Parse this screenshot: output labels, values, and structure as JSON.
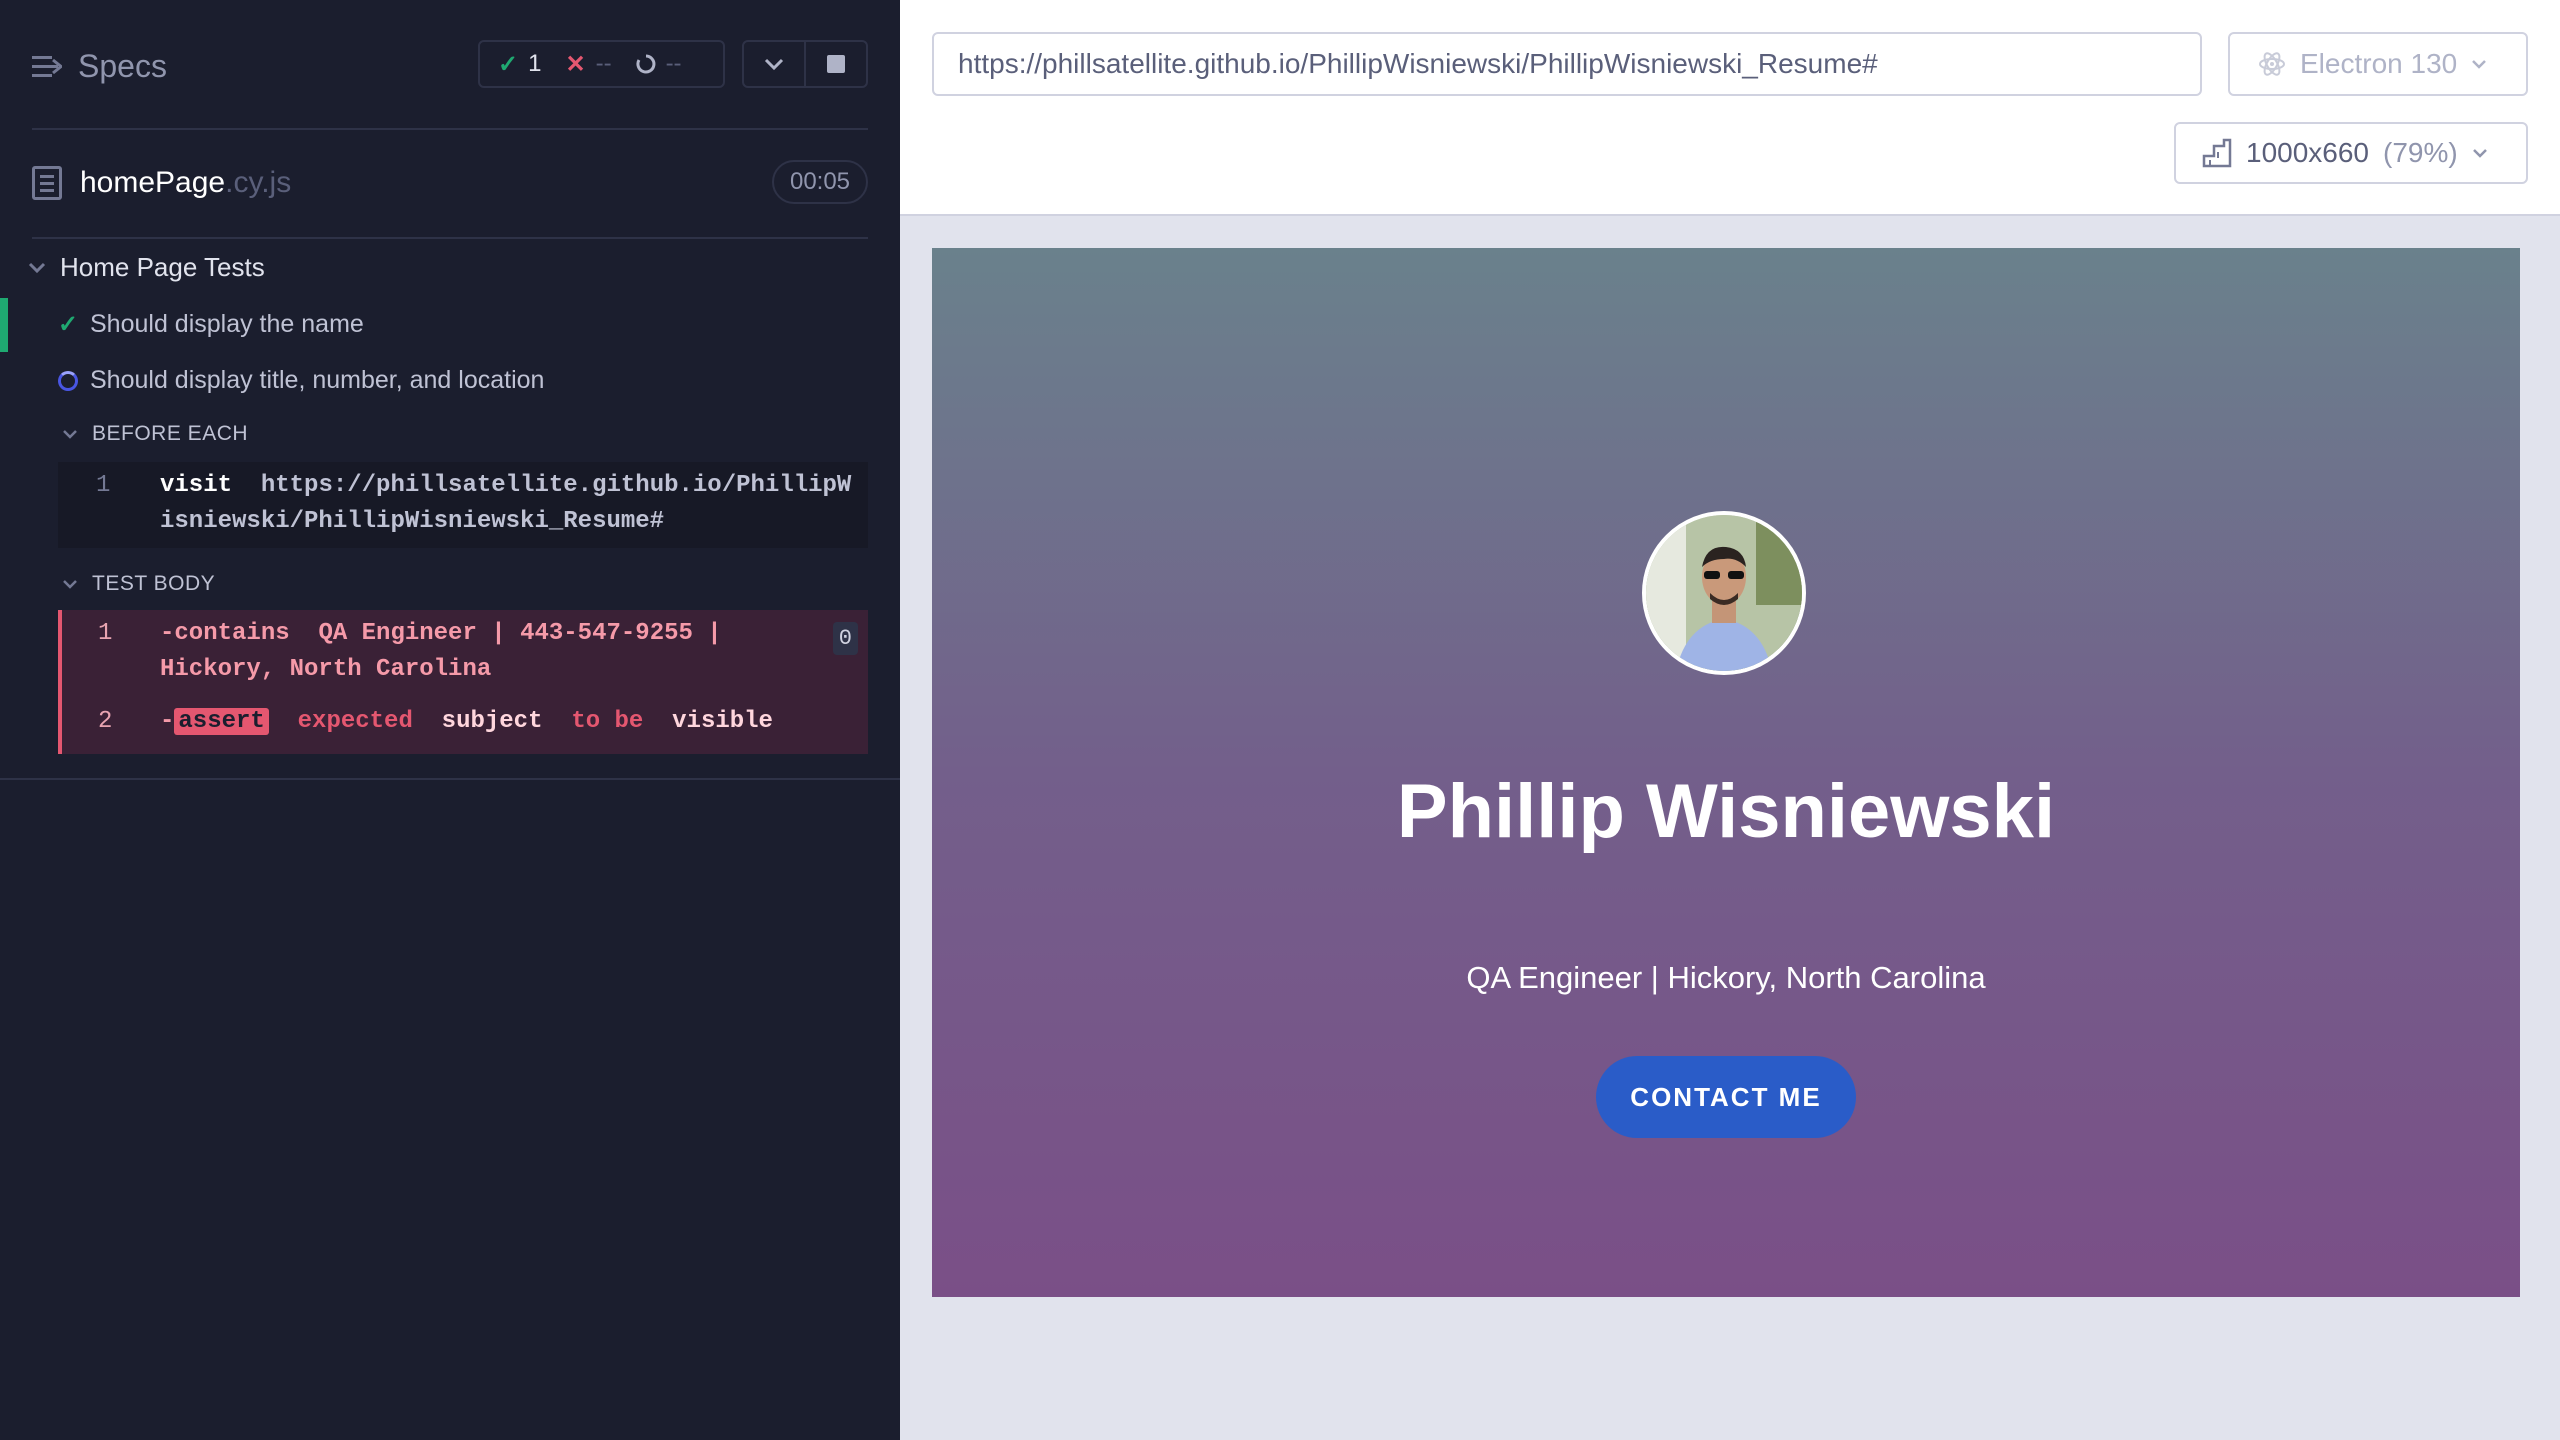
{
  "reporter": {
    "specs_label": "Specs",
    "stats": {
      "passed": "1",
      "failed": "--",
      "pending": "--"
    },
    "file": {
      "name": "homePage",
      "ext": ".cy.js",
      "duration": "00:05"
    },
    "suite": {
      "title": "Home Page Tests",
      "tests": [
        {
          "title": "Should display the name",
          "state": "passed"
        },
        {
          "title": "Should display title, number, and location",
          "state": "running"
        }
      ]
    },
    "before_each": {
      "label": "BEFORE EACH",
      "commands": [
        {
          "num": "1",
          "name": "visit",
          "arg_line1": "https://phillsatellite.github.io/PhillipW",
          "arg_line2": "isniewski/PhillipWisniewski_Resume#"
        }
      ]
    },
    "test_body": {
      "label": "TEST BODY",
      "commands": [
        {
          "num": "1",
          "name": "-contains",
          "arg_line1": "QA Engineer | 443-547-9255 |",
          "arg_line2": "Hickory, North Carolina",
          "count": "0"
        },
        {
          "num": "2",
          "prefix": "-",
          "name": "assert",
          "w1": "expected",
          "w2": "subject",
          "w3": "to be",
          "w4": "visible"
        }
      ]
    }
  },
  "aut": {
    "url": "https://phillsatellite.github.io/PhillipWisniewski/PhillipWisniewski_Resume#",
    "browser": "Electron 130",
    "viewport": "1000x660",
    "scale": "(79%)"
  },
  "preview": {
    "name": "Phillip Wisniewski",
    "subtitle": "QA Engineer | Hickory, North Carolina",
    "contact_button": "CONTACT ME"
  },
  "colors": {
    "reporter_bg": "#1b1e2e",
    "pass_green": "#1fa971",
    "fail_red": "#e45770",
    "running_blue": "#4956e3",
    "button_blue": "#2a5cc8"
  }
}
